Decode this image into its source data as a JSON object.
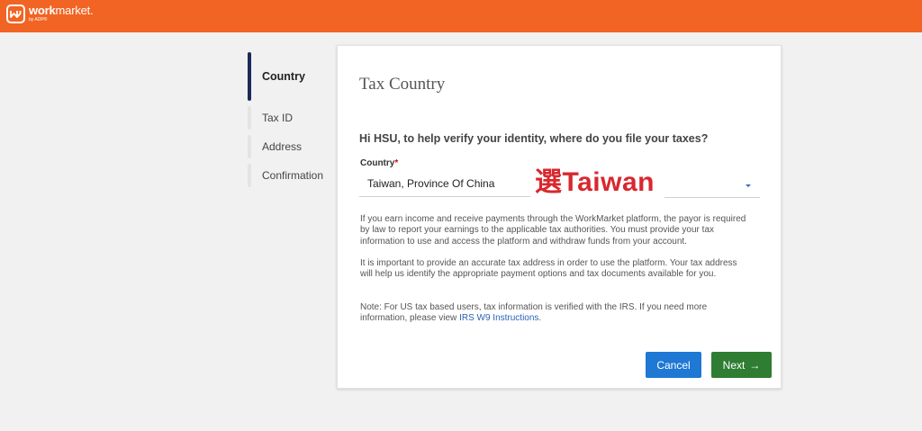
{
  "brand": {
    "name_bold": "work",
    "name_thin": "market.",
    "sub": "by ADP®",
    "accent": "#f16423"
  },
  "steps": [
    {
      "label": "Country",
      "active": true
    },
    {
      "label": "Tax ID",
      "active": false
    },
    {
      "label": "Address",
      "active": false
    },
    {
      "label": "Confirmation",
      "active": false
    }
  ],
  "card": {
    "title": "Tax Country",
    "question": "Hi HSU, to help verify your identity, where do you file your taxes?",
    "country_label": "Country",
    "required_mark": "*",
    "country_value": "Taiwan, Province Of China",
    "annotation": "選Taiwan",
    "info_p1": "If you earn income and receive payments through the WorkMarket platform, the payor is required by law to report your earnings to the applicable tax authorities. You must provide your tax information to use and access the platform and withdraw funds from your account.",
    "info_p2": "It is important to provide an accurate tax address in order to use the platform. Your tax address will help us identify the appropriate payment options and tax documents available for you.",
    "info_p3_text": "Note: For US tax based users, tax information is verified with the IRS. If you need more information, please view ",
    "info_p3_link": "IRS W9 Instructions",
    "info_p3_end": ".",
    "cancel_label": "Cancel",
    "next_label": "Next",
    "next_icon": "arrow-right-icon"
  }
}
